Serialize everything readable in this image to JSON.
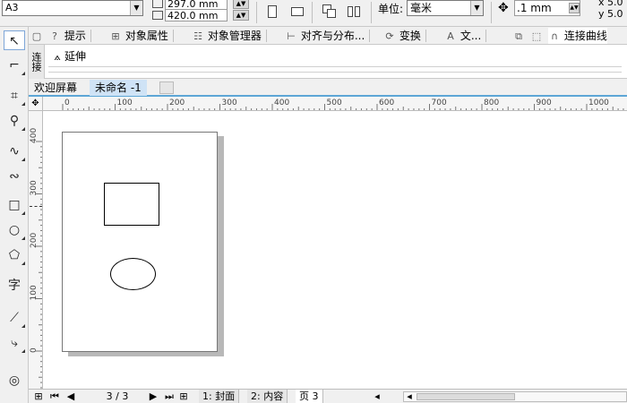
{
  "propbar": {
    "page_size": "A3",
    "width_value": "297.0 mm",
    "height_value": "420.0 mm",
    "unit_label": "单位:",
    "unit_value": "毫米",
    "nudge_value": ".1 mm",
    "dup_x": "5.0",
    "dup_y": "5.0",
    "dup_x_label": "x",
    "dup_y_label": "y"
  },
  "docker_tabs": [
    {
      "label": "提示",
      "icon": "hint-icon"
    },
    {
      "label": "对象属性",
      "icon": "object-properties-icon"
    },
    {
      "label": "对象管理器",
      "icon": "object-manager-icon"
    },
    {
      "label": "对齐与分布...",
      "icon": "align-distribute-icon"
    },
    {
      "label": "变换",
      "icon": "transform-icon"
    },
    {
      "label": "文...",
      "icon": "text-icon"
    },
    {
      "label": "连接曲线",
      "icon": "connect-curve-icon"
    }
  ],
  "docker": {
    "title": "连接",
    "extend_label": "延伸"
  },
  "doc_tabs": {
    "welcome": "欢迎屏幕",
    "untitled": "未命名 -1"
  },
  "ruler": {
    "h_ticks": [
      "0",
      "100",
      "200",
      "300",
      "400",
      "500",
      "600",
      "700",
      "800",
      "900",
      "1000"
    ],
    "v_ticks": [
      "400",
      "300",
      "200",
      "100",
      "0"
    ]
  },
  "navbar": {
    "page_count": "3 / 3",
    "pages": [
      "1: 封面",
      "2: 内容",
      "页 3"
    ]
  },
  "colors": {
    "accent": "#5da6d6",
    "active_tab": "#cfe3f6"
  }
}
